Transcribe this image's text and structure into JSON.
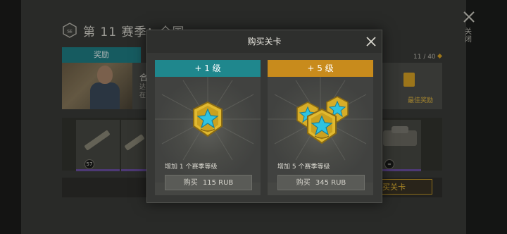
{
  "background": {
    "season_title": "第 11 赛季：全国",
    "tab_rewards": "奖励",
    "peek_text_a": "合",
    "peek_text_b": "达",
    "peek_text_c": "在",
    "progress_readout": "11 / 40",
    "best_reward_label": "最佳奖励",
    "item_level_a": "57",
    "item_level_b": "∞",
    "peek_buy_label": "买关卡",
    "close_label": "关闭"
  },
  "modal": {
    "title": "购买关卡",
    "offers": [
      {
        "banner": "+ 1 级",
        "banner_color": "#1f878d",
        "icon": "single-season-level-badge-icon",
        "description": "增加 1 个赛季等级",
        "buy_label": "购买",
        "price": "115 RUB"
      },
      {
        "banner": "+ 5 级",
        "banner_color": "#c88b1c",
        "icon": "multiple-season-level-badges-icon",
        "description": "增加 5 个赛季等级",
        "buy_label": "购买",
        "price": "345 RUB"
      }
    ]
  },
  "colors": {
    "gold": "#d8a325",
    "teal": "#1f878d",
    "orange": "#c88b1c",
    "badge_star": "#29b8d8"
  }
}
